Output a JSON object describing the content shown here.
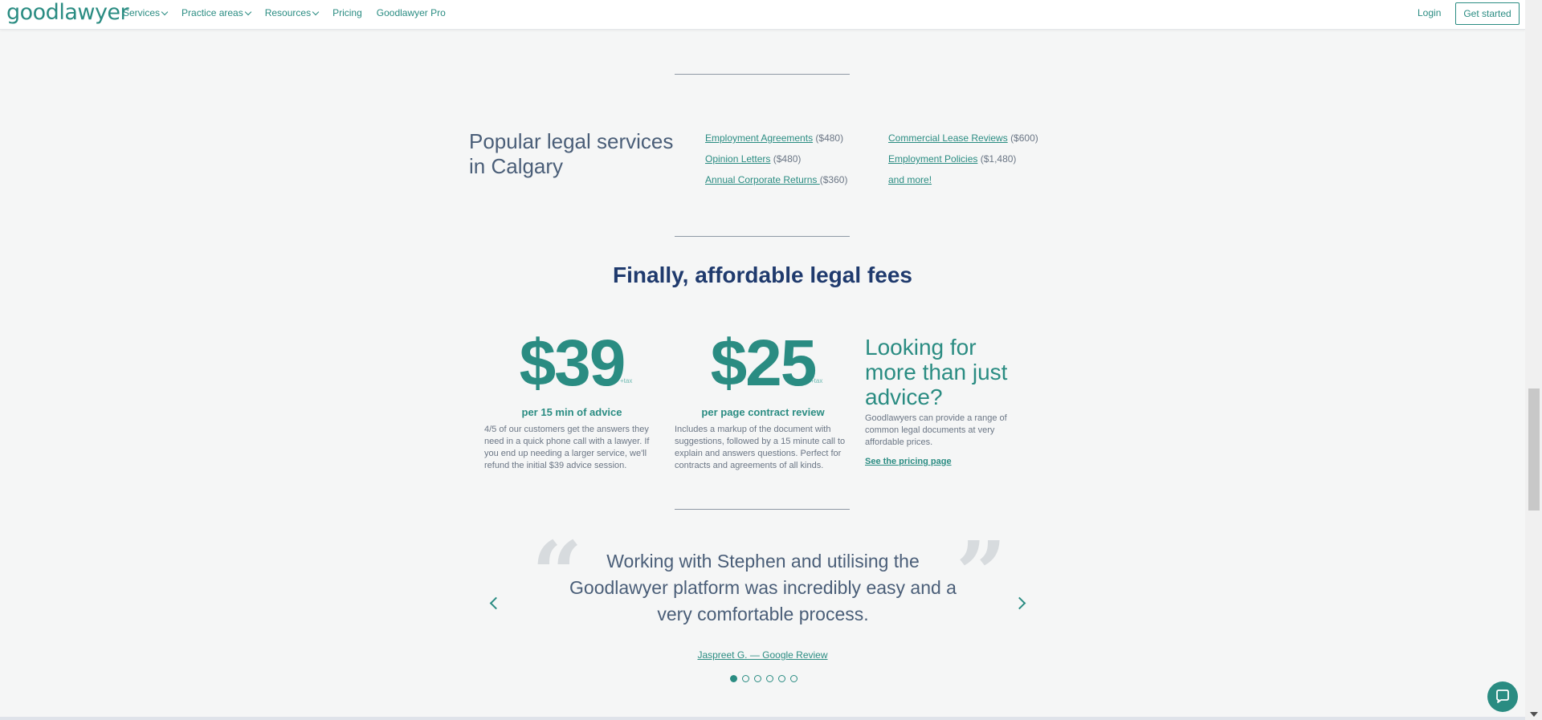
{
  "header": {
    "logo": "goodlawyer",
    "nav": [
      {
        "label": "Services",
        "dropdown": true
      },
      {
        "label": "Practice areas",
        "dropdown": true
      },
      {
        "label": "Resources",
        "dropdown": true
      },
      {
        "label": "Pricing",
        "dropdown": false
      },
      {
        "label": "Goodlawyer Pro",
        "dropdown": false
      }
    ],
    "login": "Login",
    "get_started": "Get started"
  },
  "popular": {
    "title": "Popular legal services in Calgary",
    "col1": [
      {
        "label": "Employment Agreements",
        "price": "($480)"
      },
      {
        "label": "Opinion Letters",
        "price": "($480)"
      },
      {
        "label": "Annual Corporate Returns ",
        "price": "($360)"
      }
    ],
    "col2": [
      {
        "label": "Commercial Lease Reviews",
        "price": "($600)"
      },
      {
        "label": "Employment Policies",
        "price": "($1,480)"
      },
      {
        "label": "and more!",
        "price": ""
      }
    ]
  },
  "fees": {
    "heading": "Finally, affordable legal fees",
    "advice": {
      "price": "$39",
      "tax": "+tax",
      "subtitle": "per 15 min of advice",
      "description": "4/5 of our customers get the answers they need in a quick phone call with a lawyer. If you end up needing a larger service, we'll refund the initial $39 advice session."
    },
    "review": {
      "price": "$25",
      "tax": "+tax",
      "subtitle": "per page contract review",
      "description": "Includes a markup of the document with suggestions, followed by a 15 minute call to explain and answers questions. Perfect for contracts and agreements of all kinds."
    },
    "more": {
      "title": "Looking for more than just advice?",
      "description": "Goodlawyers can provide a range of common legal documents at very affordable prices.",
      "link": "See the pricing page"
    }
  },
  "testimonial": {
    "quote": "Working with Stephen and utilising the Goodlawyer platform was incredibly easy and a very comfortable process.",
    "reviewer": "Jaspreet G. — Google Review",
    "dot_count": 6,
    "active_dot": 0
  },
  "colors": {
    "accent": "#2a8c82",
    "heading": "#1f3a6d",
    "text": "#4a5e78"
  }
}
